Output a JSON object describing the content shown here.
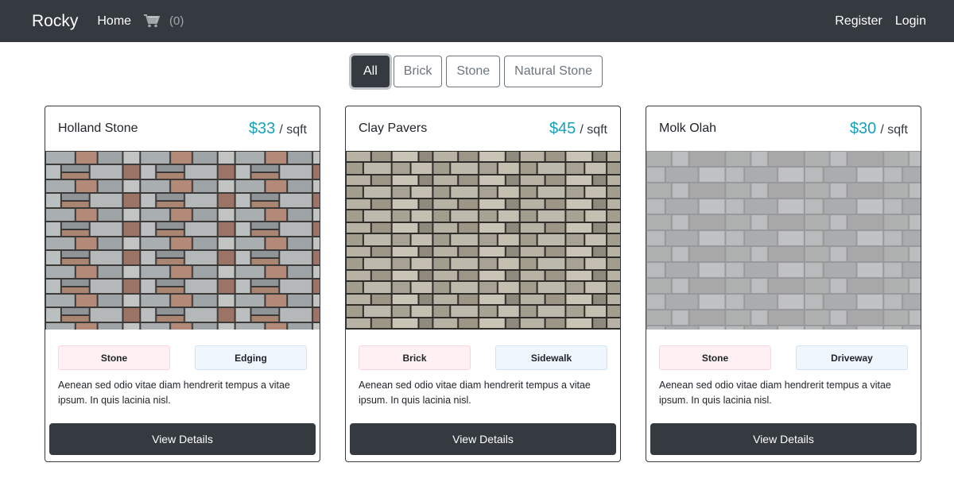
{
  "navbar": {
    "brand": "Rocky",
    "home": "Home",
    "cart_count": "(0)",
    "register": "Register",
    "login": "Login"
  },
  "filters": [
    {
      "label": "All",
      "active": true
    },
    {
      "label": "Brick",
      "active": false
    },
    {
      "label": "Stone",
      "active": false
    },
    {
      "label": "Natural Stone",
      "active": false
    }
  ],
  "products": [
    {
      "name": "Holland Stone",
      "price": "$33",
      "unit": "/ sqft",
      "material_tag": "Stone",
      "use_tag": "Edging",
      "description": "Aenean sed odio vitae diam hendrerit tempus a vitae ipsum. In quis lacinia nisl.",
      "button": "View Details"
    },
    {
      "name": "Clay Pavers",
      "price": "$45",
      "unit": "/ sqft",
      "material_tag": "Brick",
      "use_tag": "Sidewalk",
      "description": "Aenean sed odio vitae diam hendrerit tempus a vitae ipsum. In quis lacinia nisl.",
      "button": "View Details"
    },
    {
      "name": "Molk Olah",
      "price": "$30",
      "unit": "/ sqft",
      "material_tag": "Stone",
      "use_tag": "Driveway",
      "description": "Aenean sed odio vitae diam hendrerit tempus a vitae ipsum. In quis lacinia nisl.",
      "button": "View Details"
    }
  ],
  "colors": {
    "navbar_bg": "#343a40",
    "price": "#17a2b8",
    "material_tag_bg": "#fff1f3",
    "use_tag_bg": "#eff6fd"
  }
}
